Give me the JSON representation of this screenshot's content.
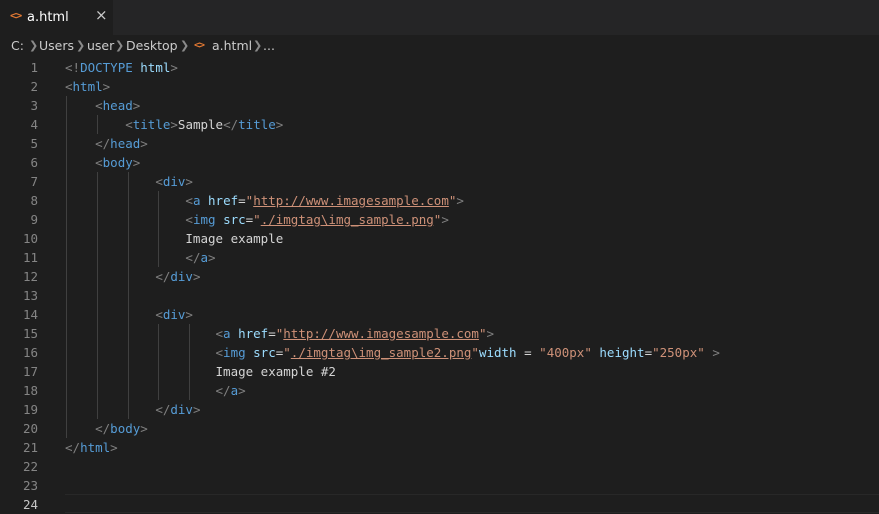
{
  "tab": {
    "label": "a.html",
    "icon": "html-file-icon",
    "close": "×"
  },
  "breadcrumb": [
    "C:",
    "Users",
    "user",
    "Desktop",
    "a.html",
    "..."
  ],
  "colors": {
    "tag_bracket": "#808080",
    "tag_name": "#569cd6",
    "attr": "#9cdcfe",
    "string": "#ce9178",
    "text": "#d4d4d4",
    "line_number": "#858585"
  },
  "editor": {
    "line_numbers": [
      "1",
      "2",
      "3",
      "4",
      "5",
      "6",
      "7",
      "8",
      "9",
      "10",
      "11",
      "12",
      "13",
      "14",
      "15",
      "16",
      "17",
      "18",
      "19",
      "20",
      "21",
      "22",
      "23",
      "24"
    ],
    "active_line": "24",
    "lines": [
      "<!DOCTYPE html>",
      "<html>",
      "    <head>",
      "        <title>Sample</title>",
      "    </head>",
      "    <body>",
      "            <div>",
      "                <a href=\"http://www.imagesample.com\">",
      "                <img src=\"./imgtag\\img_sample.png\">",
      "                Image example",
      "                </a>",
      "            </div>",
      "",
      "            <div>",
      "                    <a href=\"http://www.imagesample.com\">",
      "                    <img src=\"./imgtag\\img_sample2.png\"width = \"400px\" height=\"250px\" >",
      "                    Image example #2",
      "                    </a>",
      "            </div>",
      "    </body>",
      "</html>",
      "",
      "",
      ""
    ]
  }
}
